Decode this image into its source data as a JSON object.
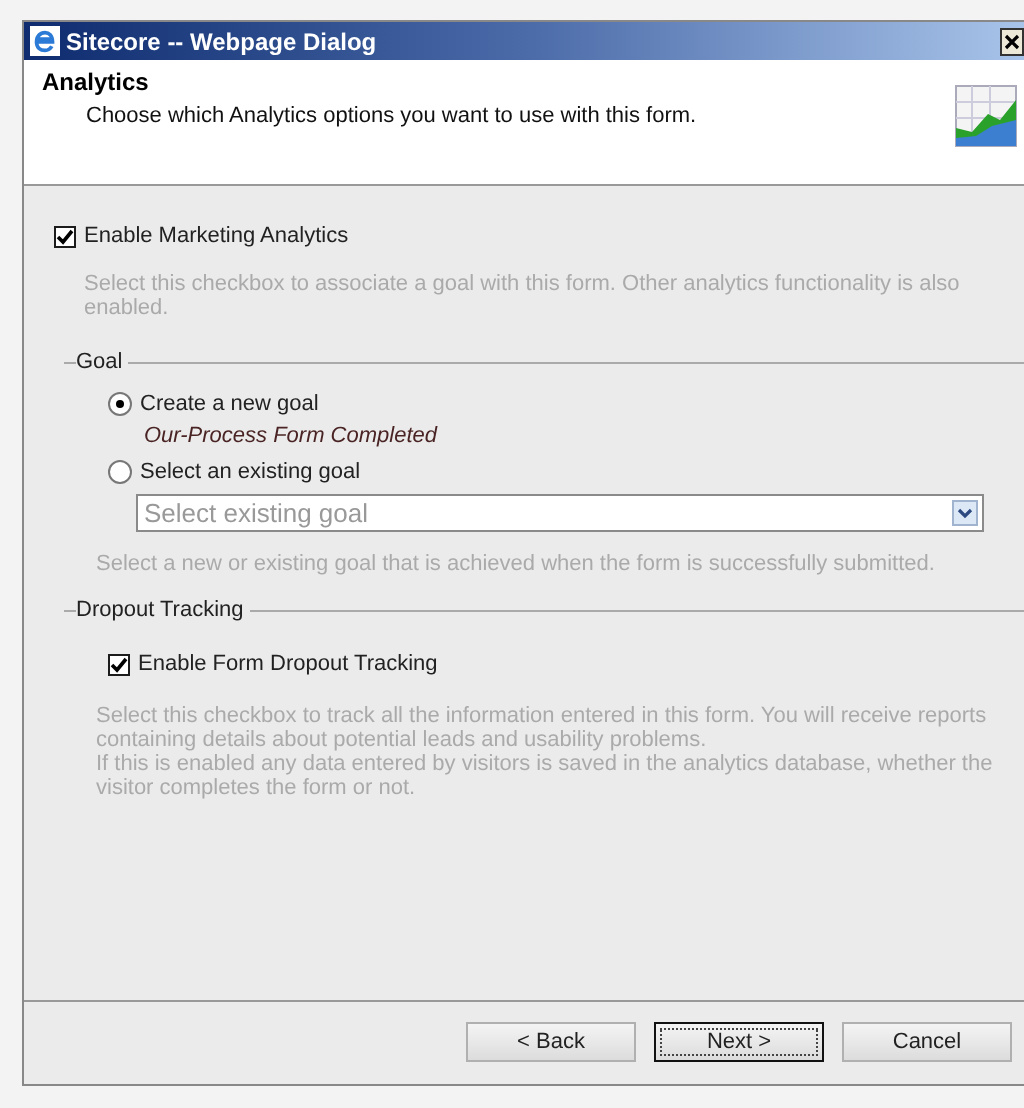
{
  "window": {
    "title": "Sitecore -- Webpage Dialog"
  },
  "header": {
    "title": "Analytics",
    "subtitle": "Choose which Analytics options you want to use with this form."
  },
  "marketing": {
    "label": "Enable Marketing Analytics",
    "checked": true,
    "help": "Select this checkbox to associate a goal with this form. Other analytics functionality is also enabled."
  },
  "goal": {
    "legend": "Goal",
    "options": [
      {
        "label": "Create a new goal",
        "selected": true,
        "note": "Our-Process Form Completed"
      },
      {
        "label": "Select an existing goal",
        "selected": false
      }
    ],
    "dropdown": {
      "placeholder": "Select existing goal"
    },
    "help": "Select a new or existing goal that is achieved when the form is successfully submitted."
  },
  "dropout": {
    "legend": "Dropout Tracking",
    "label": "Enable Form Dropout Tracking",
    "checked": true,
    "help": [
      "Select this checkbox to track all the information entered in this form. You will receive reports containing details about potential leads and usability problems.",
      "If this is enabled any data entered by visitors is saved in the analytics database, whether the visitor completes the form or not."
    ]
  },
  "buttons": [
    {
      "label": "< Back",
      "focused": false
    },
    {
      "label": "Next >",
      "focused": true
    },
    {
      "label": "Cancel",
      "focused": false
    }
  ]
}
